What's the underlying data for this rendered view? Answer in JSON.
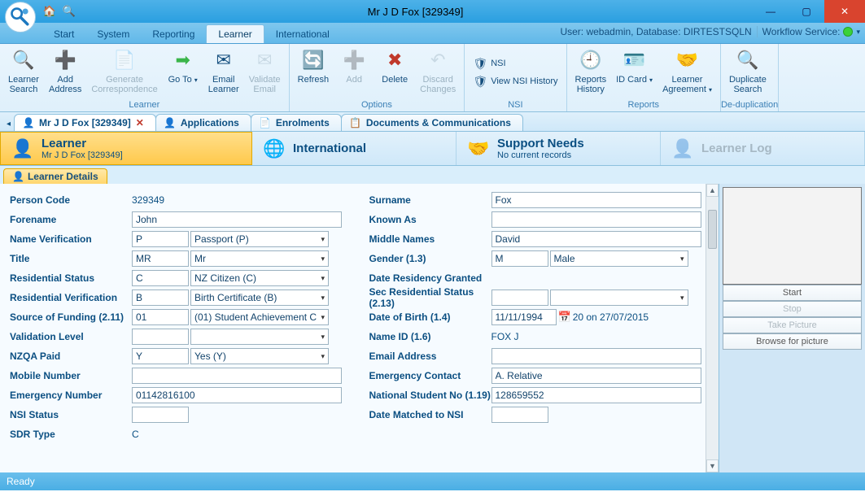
{
  "window": {
    "title": "Mr J D Fox [329349]"
  },
  "menutabs": {
    "items": [
      "Start",
      "System",
      "Reporting",
      "Learner",
      "International"
    ],
    "active": "Learner",
    "userLabel": "User: webadmin, Database: DIRTESTSQLN",
    "workflowLabel": "Workflow Service:"
  },
  "ribbon": {
    "groups": [
      {
        "label": "Learner",
        "items": [
          {
            "label": "Learner\nSearch",
            "icon": "search-icon"
          },
          {
            "label": "Add\nAddress",
            "icon": "add-address-icon"
          },
          {
            "label": "Generate\nCorrespondence",
            "icon": "generate-icon",
            "disabled": true
          },
          {
            "label": "Go To",
            "icon": "goto-icon",
            "drop": true
          },
          {
            "label": "Email\nLearner",
            "icon": "email-icon"
          },
          {
            "label": "Validate\nEmail",
            "icon": "validate-email-icon",
            "disabled": true
          }
        ]
      },
      {
        "label": "Options",
        "items": [
          {
            "label": "Refresh",
            "icon": "refresh-icon"
          },
          {
            "label": "Add",
            "icon": "add-icon",
            "disabled": true
          },
          {
            "label": "Delete",
            "icon": "delete-icon"
          },
          {
            "label": "Discard\nChanges",
            "icon": "discard-icon",
            "disabled": true
          }
        ]
      },
      {
        "label": "NSI",
        "items": [
          {
            "label": "NSI",
            "icon": "nsi-icon",
            "small": true
          },
          {
            "label": "View NSI History",
            "icon": "nsi-history-icon",
            "small": true
          }
        ]
      },
      {
        "label": "Reports",
        "items": [
          {
            "label": "Reports\nHistory",
            "icon": "reports-history-icon"
          },
          {
            "label": "ID Card",
            "icon": "idcard-icon",
            "drop": true
          },
          {
            "label": "Learner\nAgreement",
            "icon": "agreement-icon",
            "drop": true
          }
        ]
      },
      {
        "label": "De-duplication",
        "items": [
          {
            "label": "Duplicate\nSearch",
            "icon": "dup-search-icon"
          }
        ]
      }
    ]
  },
  "doctabs": [
    {
      "label": "Mr J D Fox [329349]",
      "icon": "person-icon",
      "close": true,
      "active": true
    },
    {
      "label": "Applications",
      "icon": "person-icon"
    },
    {
      "label": "Enrolments",
      "icon": "file-icon"
    },
    {
      "label": "Documents & Communications",
      "icon": "doc-icon"
    }
  ],
  "summary": [
    {
      "t1": "Learner",
      "t2": "Mr J D Fox [329349]",
      "icon": "person-icon",
      "first": true
    },
    {
      "t1": "International",
      "t2": "",
      "icon": "globe-icon"
    },
    {
      "t1": "Support Needs",
      "t2": "No current records",
      "icon": "support-icon"
    },
    {
      "t1": "Learner Log",
      "t2": "",
      "icon": "log-icon",
      "dim": true
    }
  ],
  "detailsTab": "Learner Details",
  "form": {
    "left": [
      {
        "lbl": "Person Code",
        "type": "text",
        "val": "329349"
      },
      {
        "lbl": "Forename",
        "type": "input",
        "val": "John",
        "cls": "vlong"
      },
      {
        "lbl": "Name Verification",
        "type": "code_dd",
        "code": "P",
        "dd": "Passport (P)"
      },
      {
        "lbl": "Title",
        "type": "code_dd",
        "code": "MR",
        "dd": "Mr"
      },
      {
        "lbl": "Residential Status",
        "type": "code_dd",
        "code": "C",
        "dd": "NZ Citizen (C)"
      },
      {
        "lbl": "Residential Verification",
        "type": "code_dd",
        "code": "B",
        "dd": "Birth Certificate (B)"
      },
      {
        "lbl": "Source of Funding (2.11)",
        "type": "code_dd",
        "code": "01",
        "dd": "(01) Student Achievement C"
      },
      {
        "lbl": "Validation Level",
        "type": "code_dd",
        "code": "",
        "dd": ""
      },
      {
        "lbl": "NZQA Paid",
        "type": "code_dd",
        "code": "Y",
        "dd": "Yes (Y)"
      },
      {
        "lbl": "Mobile Number",
        "type": "input",
        "val": "",
        "cls": "vlong"
      },
      {
        "lbl": "Emergency Number",
        "type": "input",
        "val": "01142816100",
        "cls": "vlong"
      },
      {
        "lbl": "NSI Status",
        "type": "input",
        "val": "",
        "cls": "short"
      },
      {
        "lbl": "SDR Type",
        "type": "text",
        "val": "C"
      }
    ],
    "right": [
      {
        "lbl": "Surname",
        "type": "input",
        "val": "Fox",
        "cls": "vlong"
      },
      {
        "lbl": "Known As",
        "type": "input",
        "val": "",
        "cls": "vlong"
      },
      {
        "lbl": "Middle Names",
        "type": "input",
        "val": "David",
        "cls": "vlong"
      },
      {
        "lbl": "Gender (1.3)",
        "type": "code_dd",
        "code": "M",
        "dd": "Male"
      },
      {
        "lbl": "Date Residency Granted",
        "type": "blank"
      },
      {
        "lbl": "Sec Residential Status (2.13)",
        "type": "code_dd",
        "code": "",
        "dd": ""
      },
      {
        "lbl": "Date of Birth (1.4)",
        "type": "date",
        "val": "11/11/1994",
        "extra": "20   on 27/07/2015"
      },
      {
        "lbl": "Name ID (1.6)",
        "type": "text",
        "val": "FOX J"
      },
      {
        "lbl": "Email Address",
        "type": "input",
        "val": "",
        "cls": "vlong"
      },
      {
        "lbl": "Emergency Contact",
        "type": "input",
        "val": "A. Relative",
        "cls": "vlong"
      },
      {
        "lbl": "National Student No (1.19)",
        "type": "input",
        "val": "128659552",
        "cls": "vlong"
      },
      {
        "lbl": "Date Matched to NSI",
        "type": "input",
        "val": "",
        "cls": "short"
      }
    ]
  },
  "picture": {
    "buttons": [
      "Start",
      "Stop",
      "Take Picture",
      "Browse for picture"
    ],
    "disabled": [
      1,
      2
    ]
  },
  "status": "Ready"
}
